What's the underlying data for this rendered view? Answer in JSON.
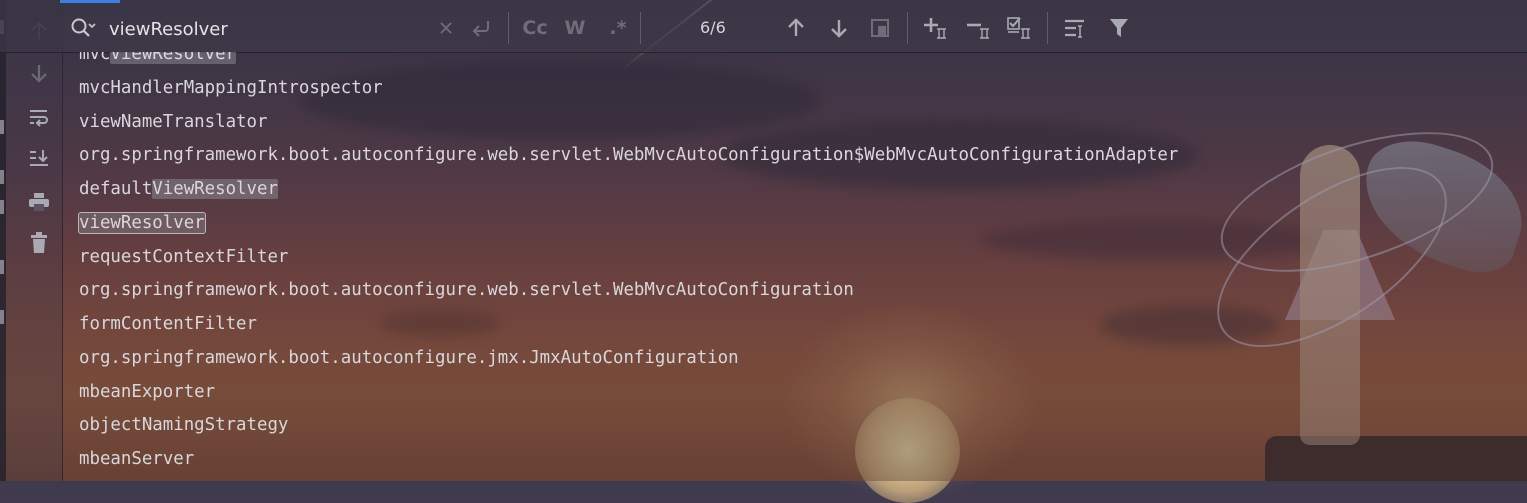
{
  "search": {
    "query": "viewResolver",
    "match_count": "6/6",
    "options": {
      "case_label": "Cc",
      "words_label": "W",
      "regex_label": ".*"
    }
  },
  "toolbar_icons": [
    "clear-search-icon",
    "replace-icon",
    "previous-match-icon",
    "next-match-icon",
    "select-all-occurrences-icon",
    "add-selection-for-next-icon",
    "remove-selection-icon",
    "select-all-matches-icon",
    "filter-lines-icon",
    "filter-icon"
  ],
  "gutter_icons": [
    "scroll-up-icon",
    "scroll-down-icon",
    "soft-wrap-icon",
    "scroll-to-end-icon",
    "print-icon",
    "clear-all-icon"
  ],
  "console": {
    "lines": [
      {
        "before": "mvc",
        "match": "ViewResolver",
        "after": ""
      },
      {
        "text": "mvcHandlerMappingIntrospector"
      },
      {
        "text": "viewNameTranslator"
      },
      {
        "text": "org.springframework.boot.autoconfigure.web.servlet.WebMvcAutoConfiguration$WebMvcAutoConfigurationAdapter"
      },
      {
        "before": "default",
        "match": "ViewResolver",
        "after": ""
      },
      {
        "before": "",
        "match": "viewResolver",
        "after": ""
      },
      {
        "text": "requestContextFilter"
      },
      {
        "text": "org.springframework.boot.autoconfigure.web.servlet.WebMvcAutoConfiguration"
      },
      {
        "text": "formContentFilter"
      },
      {
        "text": "org.springframework.boot.autoconfigure.jmx.JmxAutoConfiguration"
      },
      {
        "text": "mbeanExporter"
      },
      {
        "text": "objectNamingStrategy"
      },
      {
        "text": "mbeanServer"
      }
    ]
  },
  "colors": {
    "accent": "#3d7fe0",
    "text": "#d9d7dc",
    "highlight": "#96969f"
  }
}
